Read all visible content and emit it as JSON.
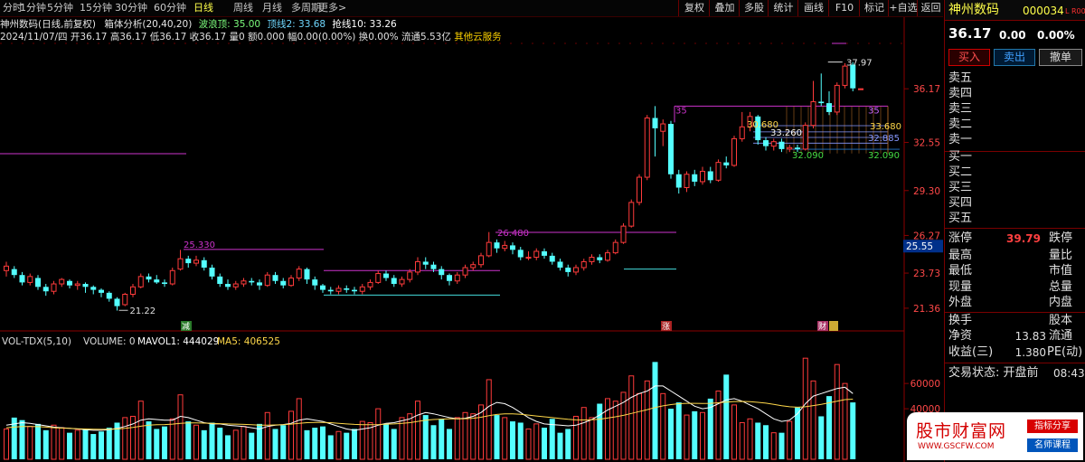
{
  "toolbar": {
    "periods": [
      "分时",
      "1分钟",
      "5分钟",
      "15分钟",
      "30分钟",
      "60分钟",
      "日线",
      "周线",
      "月线",
      "多周期",
      "更多>"
    ],
    "active_period": "日线",
    "buttons": [
      "复权",
      "叠加",
      "多股",
      "统计",
      "画线",
      "F10",
      "标记",
      "+自选",
      "返回"
    ]
  },
  "info": {
    "title": "神州数码(日线,前复权)",
    "indicator": "箱体分析(20,40,20)",
    "wave_top": "波浪顶: 35.00",
    "resist2": "顶线2: 33.68",
    "grab10": "抢线10: 33.26",
    "date": "2024/11/07/四",
    "open": "开36.17",
    "high": "高36.17",
    "low": "低36.17",
    "close": "收36.17",
    "volume": "量0",
    "amount": "额0.000",
    "amplitude": "幅0.00(0.00%)",
    "turnover": "换0.00%",
    "float_cap": "流通5.53亿",
    "service": "其他云服务"
  },
  "chart_data": {
    "type": "candlestick",
    "price_axis_ticks": [
      36.17,
      32.55,
      29.3,
      26.27,
      23.73,
      21.36
    ],
    "price_axis_current": "25.55",
    "price_range": [
      20.5,
      38.5
    ],
    "annotations": {
      "high": "37.97",
      "low": "21.22",
      "level_1": "25.330",
      "level_2": "26.480",
      "level_3": "35",
      "level_4": "33.260",
      "level_5": "32.885",
      "level_6": "32.090",
      "level_7": "30.680",
      "level_8": "33.680"
    },
    "tags": [
      "减",
      "涨",
      "财"
    ],
    "candles": [
      {
        "o": 23.9,
        "c": 24.2,
        "h": 24.5,
        "l": 23.5
      },
      {
        "o": 24.0,
        "c": 23.6,
        "h": 24.2,
        "l": 23.4
      },
      {
        "o": 23.6,
        "c": 23.1,
        "h": 23.8,
        "l": 22.9
      },
      {
        "o": 23.1,
        "c": 23.5,
        "h": 23.7,
        "l": 22.9
      },
      {
        "o": 23.4,
        "c": 22.8,
        "h": 23.6,
        "l": 22.6
      },
      {
        "o": 22.8,
        "c": 22.5,
        "h": 23.0,
        "l": 22.2
      },
      {
        "o": 22.5,
        "c": 23.0,
        "h": 23.2,
        "l": 22.3
      },
      {
        "o": 23.0,
        "c": 23.3,
        "h": 23.4,
        "l": 22.8
      },
      {
        "o": 23.2,
        "c": 22.9,
        "h": 23.3,
        "l": 22.7
      },
      {
        "o": 22.9,
        "c": 23.0,
        "h": 23.2,
        "l": 22.6
      },
      {
        "o": 23.0,
        "c": 22.8,
        "h": 23.1,
        "l": 22.4
      },
      {
        "o": 22.8,
        "c": 22.6,
        "h": 22.9,
        "l": 22.3
      },
      {
        "o": 22.6,
        "c": 22.4,
        "h": 22.7,
        "l": 22.1
      },
      {
        "o": 22.4,
        "c": 22.0,
        "h": 22.5,
        "l": 21.8
      },
      {
        "o": 22.0,
        "c": 21.5,
        "h": 22.1,
        "l": 21.2
      },
      {
        "o": 21.6,
        "c": 22.3,
        "h": 22.4,
        "l": 21.5
      },
      {
        "o": 22.3,
        "c": 22.8,
        "h": 23.0,
        "l": 22.1
      },
      {
        "o": 22.8,
        "c": 23.5,
        "h": 23.7,
        "l": 22.7
      },
      {
        "o": 23.5,
        "c": 23.3,
        "h": 23.7,
        "l": 23.1
      },
      {
        "o": 23.3,
        "c": 23.1,
        "h": 23.6,
        "l": 23.0
      },
      {
        "o": 23.1,
        "c": 23.0,
        "h": 23.3,
        "l": 22.8
      },
      {
        "o": 23.0,
        "c": 23.9,
        "h": 24.1,
        "l": 22.9
      },
      {
        "o": 24.0,
        "c": 24.7,
        "h": 25.3,
        "l": 23.9
      },
      {
        "o": 24.7,
        "c": 24.4,
        "h": 24.9,
        "l": 24.1
      },
      {
        "o": 24.4,
        "c": 24.6,
        "h": 24.9,
        "l": 24.2
      },
      {
        "o": 24.6,
        "c": 24.1,
        "h": 24.8,
        "l": 23.9
      },
      {
        "o": 24.1,
        "c": 23.5,
        "h": 24.3,
        "l": 23.3
      },
      {
        "o": 23.5,
        "c": 23.0,
        "h": 23.7,
        "l": 22.8
      },
      {
        "o": 23.0,
        "c": 22.8,
        "h": 23.3,
        "l": 22.6
      },
      {
        "o": 22.8,
        "c": 23.0,
        "h": 23.2,
        "l": 22.6
      },
      {
        "o": 23.0,
        "c": 23.2,
        "h": 23.4,
        "l": 22.8
      },
      {
        "o": 23.2,
        "c": 23.1,
        "h": 23.4,
        "l": 22.9
      },
      {
        "o": 23.1,
        "c": 22.9,
        "h": 23.3,
        "l": 22.6
      },
      {
        "o": 22.9,
        "c": 23.6,
        "h": 23.8,
        "l": 22.8
      },
      {
        "o": 23.6,
        "c": 23.2,
        "h": 23.8,
        "l": 23.0
      },
      {
        "o": 23.2,
        "c": 22.9,
        "h": 23.4,
        "l": 22.7
      },
      {
        "o": 22.9,
        "c": 23.4,
        "h": 23.6,
        "l": 22.8
      },
      {
        "o": 23.4,
        "c": 24.0,
        "h": 24.2,
        "l": 23.2
      },
      {
        "o": 24.0,
        "c": 23.3,
        "h": 24.1,
        "l": 23.0
      },
      {
        "o": 23.3,
        "c": 22.9,
        "h": 23.5,
        "l": 22.6
      },
      {
        "o": 22.9,
        "c": 22.6,
        "h": 23.0,
        "l": 22.4
      },
      {
        "o": 22.6,
        "c": 22.5,
        "h": 22.8,
        "l": 22.3
      },
      {
        "o": 22.5,
        "c": 22.7,
        "h": 22.9,
        "l": 22.3
      },
      {
        "o": 22.7,
        "c": 22.6,
        "h": 22.9,
        "l": 22.4
      },
      {
        "o": 22.6,
        "c": 22.5,
        "h": 22.8,
        "l": 22.3
      },
      {
        "o": 22.5,
        "c": 22.8,
        "h": 23.0,
        "l": 22.3
      },
      {
        "o": 22.8,
        "c": 23.1,
        "h": 23.3,
        "l": 22.6
      },
      {
        "o": 23.1,
        "c": 23.7,
        "h": 23.9,
        "l": 23.0
      },
      {
        "o": 23.7,
        "c": 23.4,
        "h": 23.9,
        "l": 23.2
      },
      {
        "o": 23.4,
        "c": 23.0,
        "h": 23.6,
        "l": 22.8
      },
      {
        "o": 23.0,
        "c": 23.3,
        "h": 23.5,
        "l": 22.8
      },
      {
        "o": 23.3,
        "c": 23.8,
        "h": 24.0,
        "l": 23.1
      },
      {
        "o": 23.8,
        "c": 24.5,
        "h": 24.8,
        "l": 23.6
      },
      {
        "o": 24.5,
        "c": 24.3,
        "h": 24.8,
        "l": 24.0
      },
      {
        "o": 24.3,
        "c": 24.0,
        "h": 24.5,
        "l": 23.8
      },
      {
        "o": 24.0,
        "c": 23.6,
        "h": 24.2,
        "l": 23.3
      },
      {
        "o": 23.6,
        "c": 23.2,
        "h": 23.7,
        "l": 22.9
      },
      {
        "o": 23.2,
        "c": 23.6,
        "h": 23.8,
        "l": 23.0
      },
      {
        "o": 23.6,
        "c": 24.1,
        "h": 24.3,
        "l": 23.4
      },
      {
        "o": 24.1,
        "c": 24.3,
        "h": 24.5,
        "l": 23.9
      },
      {
        "o": 24.3,
        "c": 24.9,
        "h": 25.1,
        "l": 24.1
      },
      {
        "o": 24.9,
        "c": 25.8,
        "h": 26.5,
        "l": 24.8
      },
      {
        "o": 25.8,
        "c": 25.4,
        "h": 26.0,
        "l": 25.1
      },
      {
        "o": 25.4,
        "c": 25.6,
        "h": 25.9,
        "l": 25.2
      },
      {
        "o": 25.6,
        "c": 25.3,
        "h": 25.8,
        "l": 25.0
      },
      {
        "o": 25.3,
        "c": 24.8,
        "h": 25.5,
        "l": 24.6
      },
      {
        "o": 24.8,
        "c": 24.8,
        "h": 25.2,
        "l": 24.6
      },
      {
        "o": 24.8,
        "c": 25.2,
        "h": 25.4,
        "l": 24.6
      },
      {
        "o": 25.2,
        "c": 24.9,
        "h": 25.4,
        "l": 24.7
      },
      {
        "o": 24.9,
        "c": 24.5,
        "h": 25.1,
        "l": 24.3
      },
      {
        "o": 24.5,
        "c": 24.1,
        "h": 24.7,
        "l": 23.9
      },
      {
        "o": 24.1,
        "c": 23.8,
        "h": 24.3,
        "l": 23.5
      },
      {
        "o": 23.8,
        "c": 24.1,
        "h": 24.3,
        "l": 23.6
      },
      {
        "o": 24.1,
        "c": 24.5,
        "h": 24.7,
        "l": 23.9
      },
      {
        "o": 24.5,
        "c": 24.8,
        "h": 25.0,
        "l": 24.3
      },
      {
        "o": 24.8,
        "c": 24.6,
        "h": 25.0,
        "l": 24.4
      },
      {
        "o": 24.6,
        "c": 25.1,
        "h": 25.3,
        "l": 24.5
      },
      {
        "o": 25.1,
        "c": 25.8,
        "h": 26.0,
        "l": 25.0
      },
      {
        "o": 25.8,
        "c": 26.9,
        "h": 27.1,
        "l": 25.7
      },
      {
        "o": 26.9,
        "c": 28.5,
        "h": 28.7,
        "l": 26.8
      },
      {
        "o": 28.5,
        "c": 30.2,
        "h": 30.4,
        "l": 28.3
      },
      {
        "o": 30.2,
        "c": 34.2,
        "h": 34.4,
        "l": 30.0
      },
      {
        "o": 34.2,
        "c": 33.5,
        "h": 35.0,
        "l": 31.6
      },
      {
        "o": 33.3,
        "c": 33.8,
        "h": 34.1,
        "l": 32.3
      },
      {
        "o": 33.8,
        "c": 30.4,
        "h": 34.0,
        "l": 30.1
      },
      {
        "o": 30.4,
        "c": 29.5,
        "h": 30.7,
        "l": 29.1
      },
      {
        "o": 29.5,
        "c": 30.4,
        "h": 30.6,
        "l": 29.2
      },
      {
        "o": 30.4,
        "c": 29.9,
        "h": 30.7,
        "l": 29.6
      },
      {
        "o": 29.9,
        "c": 30.6,
        "h": 30.9,
        "l": 29.7
      },
      {
        "o": 30.6,
        "c": 30.0,
        "h": 30.9,
        "l": 29.8
      },
      {
        "o": 30.0,
        "c": 31.2,
        "h": 31.4,
        "l": 29.9
      },
      {
        "o": 31.2,
        "c": 31.0,
        "h": 31.6,
        "l": 30.8
      },
      {
        "o": 31.0,
        "c": 32.8,
        "h": 33.0,
        "l": 30.9
      },
      {
        "o": 32.8,
        "c": 33.6,
        "h": 34.6,
        "l": 32.6
      },
      {
        "o": 33.6,
        "c": 34.3,
        "h": 34.6,
        "l": 33.3
      },
      {
        "o": 34.3,
        "c": 32.7,
        "h": 34.4,
        "l": 32.4
      },
      {
        "o": 32.7,
        "c": 32.3,
        "h": 32.9,
        "l": 32.0
      },
      {
        "o": 32.3,
        "c": 32.6,
        "h": 32.8,
        "l": 32.0
      },
      {
        "o": 32.6,
        "c": 32.1,
        "h": 32.8,
        "l": 31.9
      },
      {
        "o": 32.1,
        "c": 32.2,
        "h": 32.4,
        "l": 31.9
      },
      {
        "o": 32.2,
        "c": 32.1,
        "h": 32.4,
        "l": 31.9
      },
      {
        "o": 32.1,
        "c": 33.7,
        "h": 33.9,
        "l": 32.0
      },
      {
        "o": 33.7,
        "c": 35.3,
        "h": 36.7,
        "l": 33.5
      },
      {
        "o": 35.3,
        "c": 35.2,
        "h": 37.2,
        "l": 35.0
      },
      {
        "o": 35.2,
        "c": 34.6,
        "h": 36.0,
        "l": 34.4
      },
      {
        "o": 34.6,
        "c": 36.4,
        "h": 36.6,
        "l": 34.4
      },
      {
        "o": 36.4,
        "c": 37.7,
        "h": 37.9,
        "l": 36.2
      },
      {
        "o": 37.8,
        "c": 36.2,
        "h": 37.97,
        "l": 36.0
      },
      {
        "o": 36.17,
        "c": 36.17,
        "h": 36.17,
        "l": 36.17
      }
    ],
    "volume_header": {
      "name": "VOL-TDX(5,10)",
      "volume": "VOLUME: 0",
      "mavol1": "MAVOL1: 444029",
      "ma5": "MA5: 406525"
    },
    "volume_axis_ticks": [
      60000,
      40000
    ],
    "volume_range": [
      0,
      88000
    ],
    "volumes": [
      24000,
      33000,
      31000,
      26000,
      28000,
      23000,
      27000,
      25000,
      21000,
      23000,
      24000,
      20000,
      22000,
      25000,
      29000,
      33000,
      34000,
      46000,
      30000,
      24000,
      26000,
      32000,
      51000,
      30000,
      27000,
      23000,
      29000,
      25000,
      19000,
      23000,
      26000,
      21000,
      28000,
      37000,
      24000,
      27000,
      38000,
      48000,
      23000,
      25000,
      26000,
      19000,
      22000,
      21000,
      24000,
      30000,
      29000,
      40000,
      28000,
      24000,
      33000,
      36000,
      46000,
      35000,
      27000,
      32000,
      24000,
      33000,
      37000,
      36000,
      43000,
      63000,
      35000,
      33000,
      30000,
      29000,
      24000,
      28000,
      25000,
      32000,
      21000,
      24000,
      34000,
      41000,
      33000,
      44000,
      48000,
      46000,
      53000,
      66000,
      52000,
      62000,
      77000,
      52000,
      40000,
      45000,
      35000,
      38000,
      37000,
      48000,
      54000,
      67000,
      43000,
      29000,
      32000,
      29000,
      27000,
      21000,
      21000,
      30000,
      41000,
      80000,
      62000,
      34000,
      50000,
      75000,
      60000,
      45000
    ],
    "ma_line": [
      27000,
      28000,
      29000,
      28500,
      27500,
      26500,
      25500,
      25000,
      24500,
      24000,
      23500,
      23000,
      23000,
      23500,
      24500,
      26000,
      28000,
      31000,
      32000,
      31500,
      31000,
      31000,
      34000,
      33000,
      31000,
      29000,
      28000,
      28000,
      27000,
      26500,
      26000,
      25000,
      24000,
      26000,
      27000,
      27500,
      28500,
      31000,
      32000,
      31000,
      30000,
      28000,
      26000,
      24000,
      23000,
      24000,
      25000,
      27000,
      28500,
      29000,
      30500,
      32000,
      35000,
      37000,
      36000,
      34500,
      33000,
      32000,
      32500,
      34000,
      37000,
      42000,
      45000,
      44000,
      41000,
      37000,
      33000,
      30000,
      28000,
      27500,
      27000,
      26500,
      27000,
      29000,
      31500,
      35000,
      39000,
      42000,
      45000,
      49000,
      52000,
      54000,
      58000,
      58000,
      54000,
      50000,
      46000,
      42000,
      40000,
      41000,
      44000,
      47000,
      48000,
      46000,
      43000,
      40000,
      36000,
      32000,
      30000,
      31000,
      36000,
      44000,
      50000,
      52000,
      54000,
      56000,
      57000,
      52000
    ],
    "ma_line2": [
      25000,
      25500,
      26000,
      26000,
      25800,
      25500,
      25000,
      24700,
      24500,
      24200,
      24000,
      23800,
      23700,
      23800,
      24000,
      24500,
      25200,
      26200,
      27000,
      27300,
      27500,
      27800,
      28500,
      28800,
      28800,
      28600,
      28400,
      28200,
      28000,
      27800,
      27600,
      27300,
      27000,
      27000,
      27200,
      27400,
      27800,
      28500,
      29000,
      29200,
      29200,
      29000,
      28500,
      28000,
      27600,
      27400,
      27300,
      27500,
      27800,
      28000,
      28400,
      29000,
      30000,
      31000,
      31500,
      31800,
      32000,
      32000,
      32100,
      32500,
      33300,
      34500,
      35500,
      36000,
      36000,
      35600,
      35000,
      34300,
      33600,
      33000,
      32300,
      31600,
      31200,
      31100,
      31300,
      31800,
      32600,
      33600,
      34800,
      36300,
      37800,
      39300,
      41000,
      42300,
      43300,
      44000,
      44300,
      44300,
      44200,
      44300,
      44700,
      45300,
      45700,
      45800,
      45600,
      45100,
      44400,
      43400,
      42400,
      41600,
      41200,
      41600,
      42500,
      43500,
      44700,
      46000,
      47200,
      47600
    ]
  },
  "right_panel": {
    "name": "神州数码",
    "code": "000034",
    "badge": "L R000",
    "price": "36.17",
    "change": "0.00",
    "change_pct": "0.00%",
    "btn_buy": "买入",
    "btn_sell": "卖出",
    "btn_cancel": "撤单",
    "asks": [
      "卖五",
      "卖四",
      "卖三",
      "卖二",
      "卖一"
    ],
    "bids": [
      "买一",
      "买二",
      "买三",
      "买四",
      "买五"
    ],
    "limit_up_label": "涨停",
    "limit_up_value": "39.79",
    "limit_down_label": "跌停",
    "high_label": "最高",
    "volume_ratio_label": "量比",
    "low_label": "最低",
    "market_value_label": "市值",
    "current_volume_label": "现量",
    "total_volume_label": "总量",
    "outer_label": "外盘",
    "inner_label": "内盘",
    "turnover_label": "换手",
    "capital_label": "股本",
    "net_assets_label": "净资",
    "net_assets_value": "13.83",
    "float_label": "流通",
    "eps_label": "收益(三)",
    "eps_value": "1.380",
    "pe_label": "PE(动)",
    "trade_status": "交易状态: 开盘前",
    "time": "08:43"
  },
  "watermark": {
    "title": "股市财富网",
    "url": "WWW.GSCFW.COM",
    "tag1": "指标分享",
    "tag2": "名师课程"
  }
}
